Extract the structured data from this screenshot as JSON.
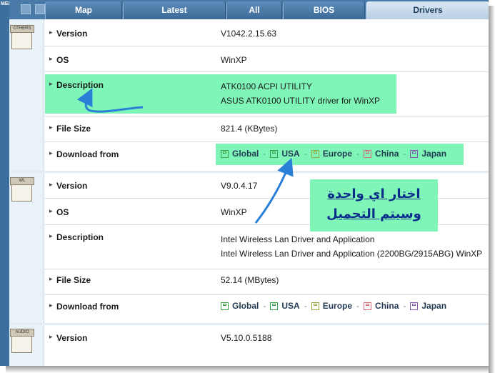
{
  "menu_label": "MENU",
  "tabs": [
    {
      "label": "Map"
    },
    {
      "label": "Latest"
    },
    {
      "label": "All"
    },
    {
      "label": "BIOS"
    },
    {
      "label": "Drivers"
    }
  ],
  "drivers": [
    {
      "icon_tag": "OTHERS",
      "version_label": "Version",
      "version": "V1042.2.15.63",
      "os_label": "OS",
      "os": "WinXP",
      "description_label": "Description",
      "description_line1": "ATK0100 ACPI UTILITY",
      "description_line2": "ASUS ATK0100 UTILITY driver for WinXP",
      "filesize_label": "File Size",
      "filesize": "821.4 (KBytes)",
      "download_label": "Download from"
    },
    {
      "icon_tag": "WL",
      "version_label": "Version",
      "version": "V9.0.4.17",
      "os_label": "OS",
      "os": "WinXP",
      "description_label": "Description",
      "description_line1": "Intel Wireless Lan Driver and Application",
      "description_line2": "Intel Wireless Lan Driver and Application (2200BG/2915ABG) WinXP",
      "filesize_label": "File Size",
      "filesize": "52.14 (MBytes)",
      "download_label": "Download from"
    },
    {
      "icon_tag": "AUDIO",
      "version_label": "Version",
      "version": "V5.10.0.5188"
    }
  ],
  "mirrors": [
    {
      "label": "Global",
      "color": "#3aa04a"
    },
    {
      "label": "USA",
      "color": "#3aa04a"
    },
    {
      "label": "Europe",
      "color": "#9aa83a"
    },
    {
      "label": "China",
      "color": "#d86a7a"
    },
    {
      "label": "Japan",
      "color": "#8a5ab0"
    }
  ],
  "annotation": {
    "line1": "اختار اي واحدة",
    "line2": "وسيتم التحميل",
    "highlight_color": "#7ff5b7",
    "arrow_color": "#2a7fd6"
  }
}
